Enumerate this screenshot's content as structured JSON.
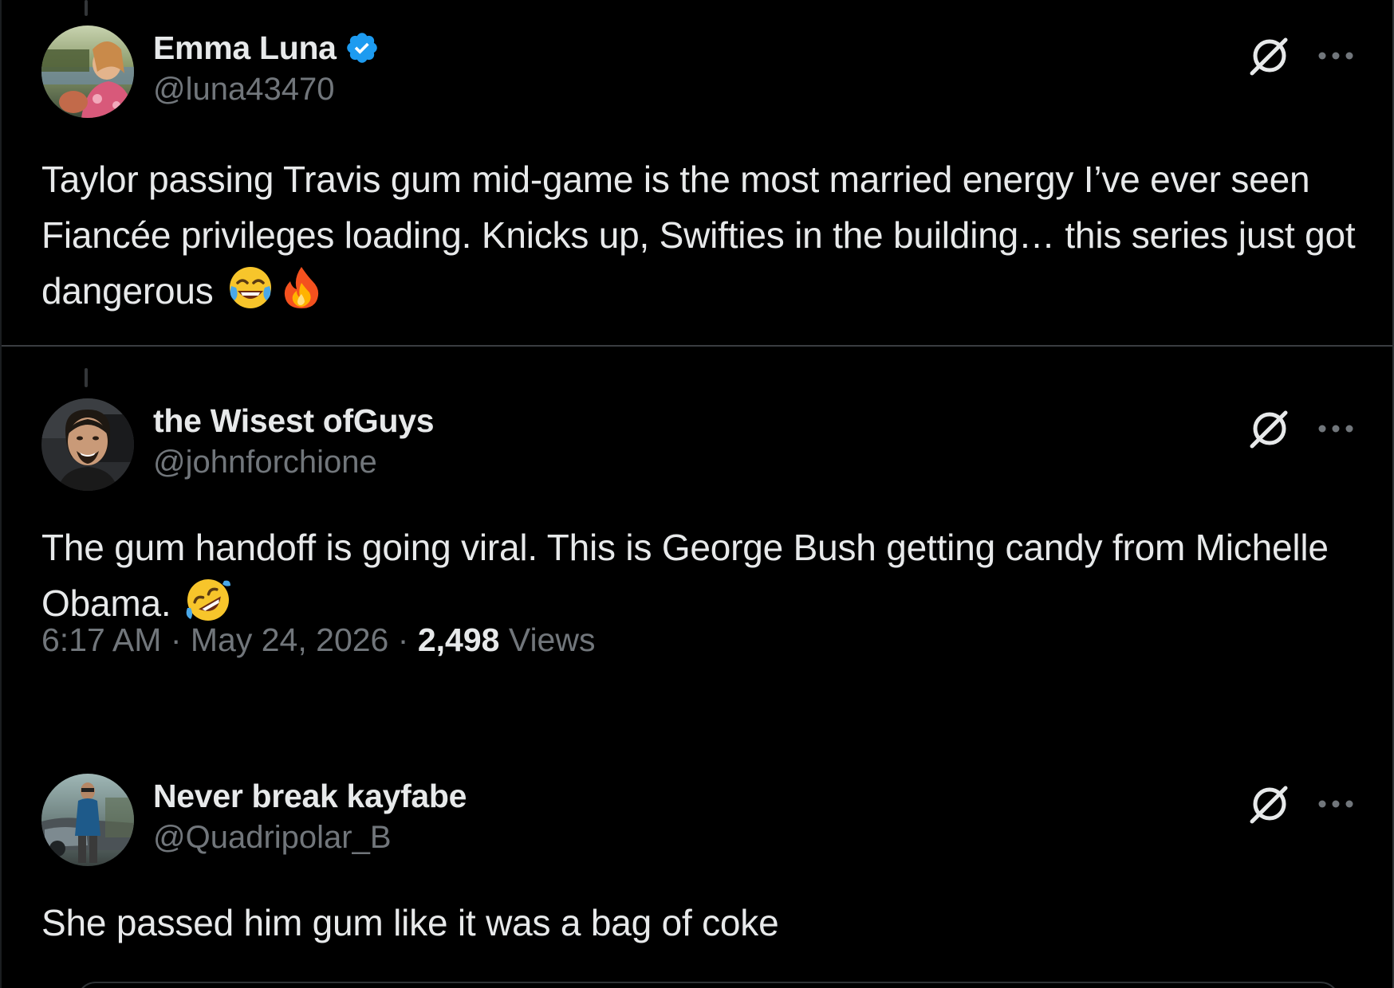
{
  "tweets": [
    {
      "display_name": "Emma Luna",
      "verified": true,
      "handle": "@luna43470",
      "text": "Taylor passing Travis gum mid-game is the most married energy I’ve ever seen  Fiancée privileges loading. Knicks up, Swifties in the building… this series just got dangerous",
      "emojis": [
        "face-with-tears-of-joy",
        "fire"
      ]
    },
    {
      "display_name": "the Wisest ofGuys",
      "verified": false,
      "handle": "@johnforchione",
      "text": "The gum handoff is going viral. This is George Bush getting candy from Michelle Obama.",
      "emojis": [
        "rolling-on-floor-laughing"
      ],
      "time": "6:17 AM",
      "separator": "·",
      "date": "May 24, 2026",
      "views_count": "2,498",
      "views_label": "Views"
    },
    {
      "display_name": "Never break kayfabe",
      "verified": false,
      "handle": "@Quadripolar_B",
      "text": "She passed him gum like it was a bag of coke",
      "emojis": []
    }
  ],
  "icons": {
    "verified": "verified-badge-icon",
    "grok": "grok-icon",
    "more": "more-options-icon"
  },
  "colors": {
    "background": "#000000",
    "text_primary": "#e7e9ea",
    "text_secondary": "#71767b",
    "verified_blue": "#1d9bf0",
    "divider": "#2f3336"
  }
}
